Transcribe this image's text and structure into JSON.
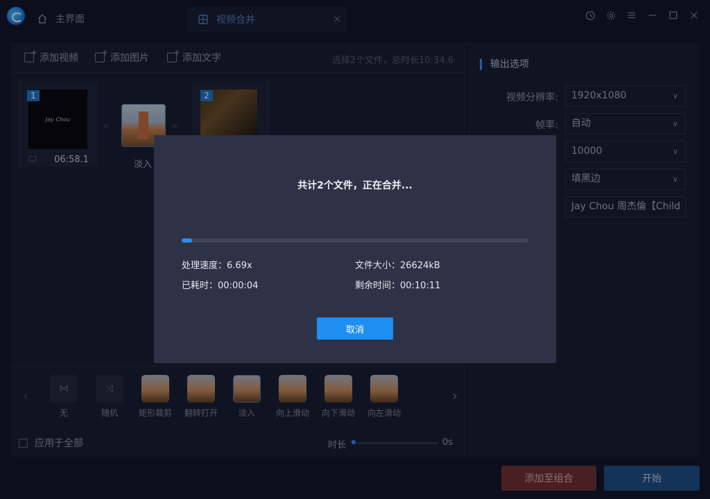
{
  "titlebar": {
    "home_tab": "主界面",
    "merge_tab": "视频合并",
    "tab_close": "×"
  },
  "toolbar": {
    "add_video": "添加视频",
    "add_image": "添加图片",
    "add_text": "添加文字",
    "summary": "选择2个文件，总时长10:34.6"
  },
  "clips": [
    {
      "index": "1",
      "thumb_text": "Jay Chou",
      "duration": "06:58.1"
    },
    {
      "index": "2"
    }
  ],
  "transition_label": "淡入",
  "transitions": [
    {
      "label": "无",
      "icon": "bowtie-icon"
    },
    {
      "label": "随机",
      "icon": "shuffle-icon"
    },
    {
      "label": "矩形裁剪"
    },
    {
      "label": "翻转打开"
    },
    {
      "label": "淡入"
    },
    {
      "label": "向上滑动"
    },
    {
      "label": "向下滑动"
    },
    {
      "label": "向左滑动"
    }
  ],
  "apply_all": "应用于全部",
  "duration_label": "时长",
  "duration_value": "0s",
  "output": {
    "title": "输出选项",
    "resolution_label": "视频分辨率:",
    "resolution": "1920x1080",
    "framerate_label": "帧率:",
    "framerate": "自动",
    "bitrate": "10000",
    "fill": "填黑边",
    "filename": "Jay Chou 周杰倫【Child"
  },
  "buttons": {
    "add_combo": "添加至组合",
    "start": "开始"
  },
  "modal": {
    "title": "共计2个文件，正在合并...",
    "progress": 0.03,
    "speed_label": "处理速度：",
    "speed": "6.69x",
    "size_label": "文件大小：",
    "size": "26624kB",
    "elapsed_label": "已耗时：",
    "elapsed": "00:00:04",
    "remaining_label": "剩余时间：",
    "remaining": "00:10:11",
    "cancel": "取消"
  },
  "colors": {
    "accent": "#2d8cf0",
    "background": "#0e1221",
    "panel": "#151b2b",
    "modal": "#2e3246"
  }
}
